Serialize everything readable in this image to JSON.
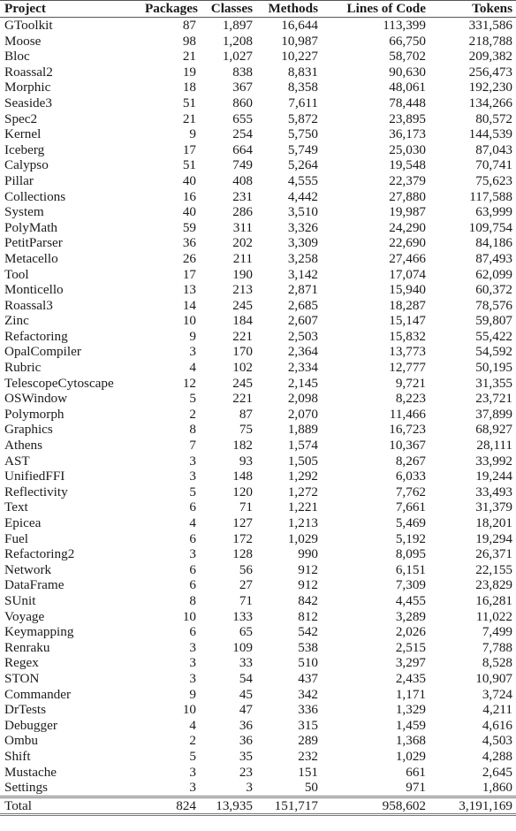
{
  "table": {
    "headers": [
      "Project",
      "Packages",
      "Classes",
      "Methods",
      "Lines of Code",
      "Tokens"
    ],
    "rows": [
      [
        "GToolkit",
        "87",
        "1,897",
        "16,644",
        "113,399",
        "331,586"
      ],
      [
        "Moose",
        "98",
        "1,208",
        "10,987",
        "66,750",
        "218,788"
      ],
      [
        "Bloc",
        "21",
        "1,027",
        "10,227",
        "58,702",
        "209,382"
      ],
      [
        "Roassal2",
        "19",
        "838",
        "8,831",
        "90,630",
        "256,473"
      ],
      [
        "Morphic",
        "18",
        "367",
        "8,358",
        "48,061",
        "192,230"
      ],
      [
        "Seaside3",
        "51",
        "860",
        "7,611",
        "78,448",
        "134,266"
      ],
      [
        "Spec2",
        "21",
        "655",
        "5,872",
        "23,895",
        "80,572"
      ],
      [
        "Kernel",
        "9",
        "254",
        "5,750",
        "36,173",
        "144,539"
      ],
      [
        "Iceberg",
        "17",
        "664",
        "5,749",
        "25,030",
        "87,043"
      ],
      [
        "Calypso",
        "51",
        "749",
        "5,264",
        "19,548",
        "70,741"
      ],
      [
        "Pillar",
        "40",
        "408",
        "4,555",
        "22,379",
        "75,623"
      ],
      [
        "Collections",
        "16",
        "231",
        "4,442",
        "27,880",
        "117,588"
      ],
      [
        "System",
        "40",
        "286",
        "3,510",
        "19,987",
        "63,999"
      ],
      [
        "PolyMath",
        "59",
        "311",
        "3,326",
        "24,290",
        "109,754"
      ],
      [
        "PetitParser",
        "36",
        "202",
        "3,309",
        "22,690",
        "84,186"
      ],
      [
        "Metacello",
        "26",
        "211",
        "3,258",
        "27,466",
        "87,493"
      ],
      [
        "Tool",
        "17",
        "190",
        "3,142",
        "17,074",
        "62,099"
      ],
      [
        "Monticello",
        "13",
        "213",
        "2,871",
        "15,940",
        "60,372"
      ],
      [
        "Roassal3",
        "14",
        "245",
        "2,685",
        "18,287",
        "78,576"
      ],
      [
        "Zinc",
        "10",
        "184",
        "2,607",
        "15,147",
        "59,807"
      ],
      [
        "Refactoring",
        "9",
        "221",
        "2,503",
        "15,832",
        "55,422"
      ],
      [
        "OpalCompiler",
        "3",
        "170",
        "2,364",
        "13,773",
        "54,592"
      ],
      [
        "Rubric",
        "4",
        "102",
        "2,334",
        "12,777",
        "50,195"
      ],
      [
        "TelescopeCytoscape",
        "12",
        "245",
        "2,145",
        "9,721",
        "31,355"
      ],
      [
        "OSWindow",
        "5",
        "221",
        "2,098",
        "8,223",
        "23,721"
      ],
      [
        "Polymorph",
        "2",
        "87",
        "2,070",
        "11,466",
        "37,899"
      ],
      [
        "Graphics",
        "8",
        "75",
        "1,889",
        "16,723",
        "68,927"
      ],
      [
        "Athens",
        "7",
        "182",
        "1,574",
        "10,367",
        "28,111"
      ],
      [
        "AST",
        "3",
        "93",
        "1,505",
        "8,267",
        "33,992"
      ],
      [
        "UnifiedFFI",
        "3",
        "148",
        "1,292",
        "6,033",
        "19,244"
      ],
      [
        "Reflectivity",
        "5",
        "120",
        "1,272",
        "7,762",
        "33,493"
      ],
      [
        "Text",
        "6",
        "71",
        "1,221",
        "7,661",
        "31,379"
      ],
      [
        "Epicea",
        "4",
        "127",
        "1,213",
        "5,469",
        "18,201"
      ],
      [
        "Fuel",
        "6",
        "172",
        "1,029",
        "5,192",
        "19,294"
      ],
      [
        "Refactoring2",
        "3",
        "128",
        "990",
        "8,095",
        "26,371"
      ],
      [
        "Network",
        "6",
        "56",
        "912",
        "6,151",
        "22,155"
      ],
      [
        "DataFrame",
        "6",
        "27",
        "912",
        "7,309",
        "23,829"
      ],
      [
        "SUnit",
        "8",
        "71",
        "842",
        "4,455",
        "16,281"
      ],
      [
        "Voyage",
        "10",
        "133",
        "812",
        "3,289",
        "11,022"
      ],
      [
        "Keymapping",
        "6",
        "65",
        "542",
        "2,026",
        "7,499"
      ],
      [
        "Renraku",
        "3",
        "109",
        "538",
        "2,515",
        "7,788"
      ],
      [
        "Regex",
        "3",
        "33",
        "510",
        "3,297",
        "8,528"
      ],
      [
        "STON",
        "3",
        "54",
        "437",
        "2,435",
        "10,907"
      ],
      [
        "Commander",
        "9",
        "45",
        "342",
        "1,171",
        "3,724"
      ],
      [
        "DrTests",
        "10",
        "47",
        "336",
        "1,329",
        "4,211"
      ],
      [
        "Debugger",
        "4",
        "36",
        "315",
        "1,459",
        "4,616"
      ],
      [
        "Ombu",
        "2",
        "36",
        "289",
        "1,368",
        "4,503"
      ],
      [
        "Shift",
        "5",
        "35",
        "232",
        "1,029",
        "4,288"
      ],
      [
        "Mustache",
        "3",
        "23",
        "151",
        "661",
        "2,645"
      ],
      [
        "Settings",
        "3",
        "3",
        "50",
        "971",
        "1,860"
      ]
    ],
    "total": [
      "Total",
      "824",
      "13,935",
      "151,717",
      "958,602",
      "3,191,169"
    ]
  }
}
